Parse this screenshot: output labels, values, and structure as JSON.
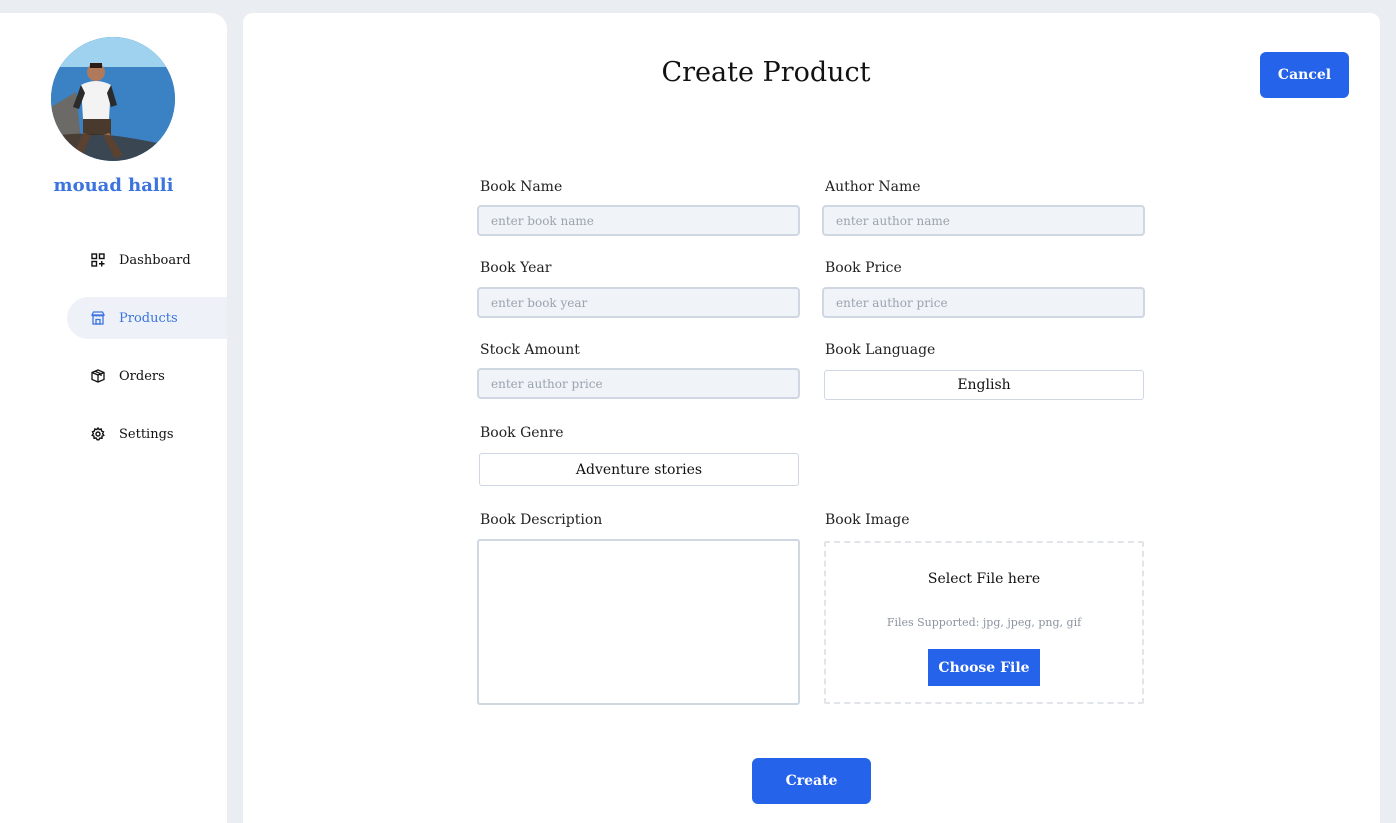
{
  "sidebar": {
    "username": "mouad halli",
    "nav": [
      {
        "label": "Dashboard",
        "icon": "dashboard-icon"
      },
      {
        "label": "Products",
        "icon": "store-icon",
        "active": true
      },
      {
        "label": "Orders",
        "icon": "box-icon"
      },
      {
        "label": "Settings",
        "icon": "gear-icon"
      }
    ]
  },
  "header": {
    "title": "Create Product",
    "cancel_label": "Cancel"
  },
  "form": {
    "book_name": {
      "label": "Book Name",
      "placeholder": "enter book name"
    },
    "author_name": {
      "label": "Author Name",
      "placeholder": "enter author name"
    },
    "book_year": {
      "label": "Book Year",
      "placeholder": "enter book year"
    },
    "book_price": {
      "label": "Book Price",
      "placeholder": "enter author price"
    },
    "stock_amount": {
      "label": "Stock Amount",
      "placeholder": "enter author price"
    },
    "book_language": {
      "label": "Book Language",
      "value": "English"
    },
    "book_genre": {
      "label": "Book Genre",
      "value": "Adventure stories"
    },
    "book_description": {
      "label": "Book Description"
    },
    "book_image": {
      "label": "Book Image",
      "title": "Select File here",
      "supported": "Files Supported: jpg, jpeg, png, gif",
      "button": "Choose File"
    },
    "create_label": "Create"
  },
  "colors": {
    "accent": "#2563eb",
    "link": "#3b74df",
    "background": "#eaeef3"
  }
}
